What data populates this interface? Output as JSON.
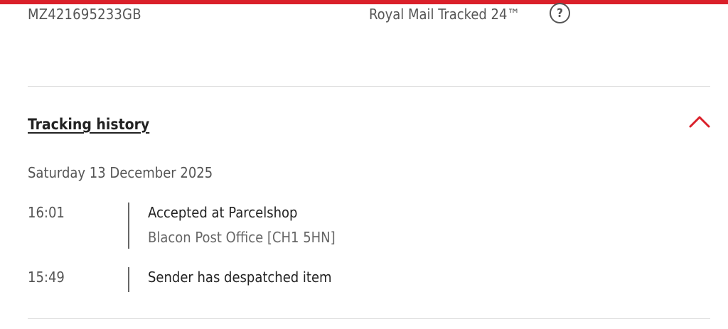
{
  "header": {
    "tracking_number": "MZ421695233GB",
    "service": "Royal Mail Tracked 24™",
    "help_glyph": "?"
  },
  "history": {
    "heading": "Tracking history",
    "expanded": true,
    "toggle_icon": "chevron-up-icon",
    "date": "Saturday 13 December 2025",
    "events": [
      {
        "time": "16:01",
        "title": "Accepted at Parcelshop",
        "location": "Blacon Post Office [CH1 5HN]"
      },
      {
        "time": "15:49",
        "title": "Sender has despatched item",
        "location": ""
      }
    ]
  },
  "colors": {
    "brand_red": "#da202a",
    "text_dark": "#222222",
    "text_muted": "#555555",
    "divider": "#dddddd"
  }
}
